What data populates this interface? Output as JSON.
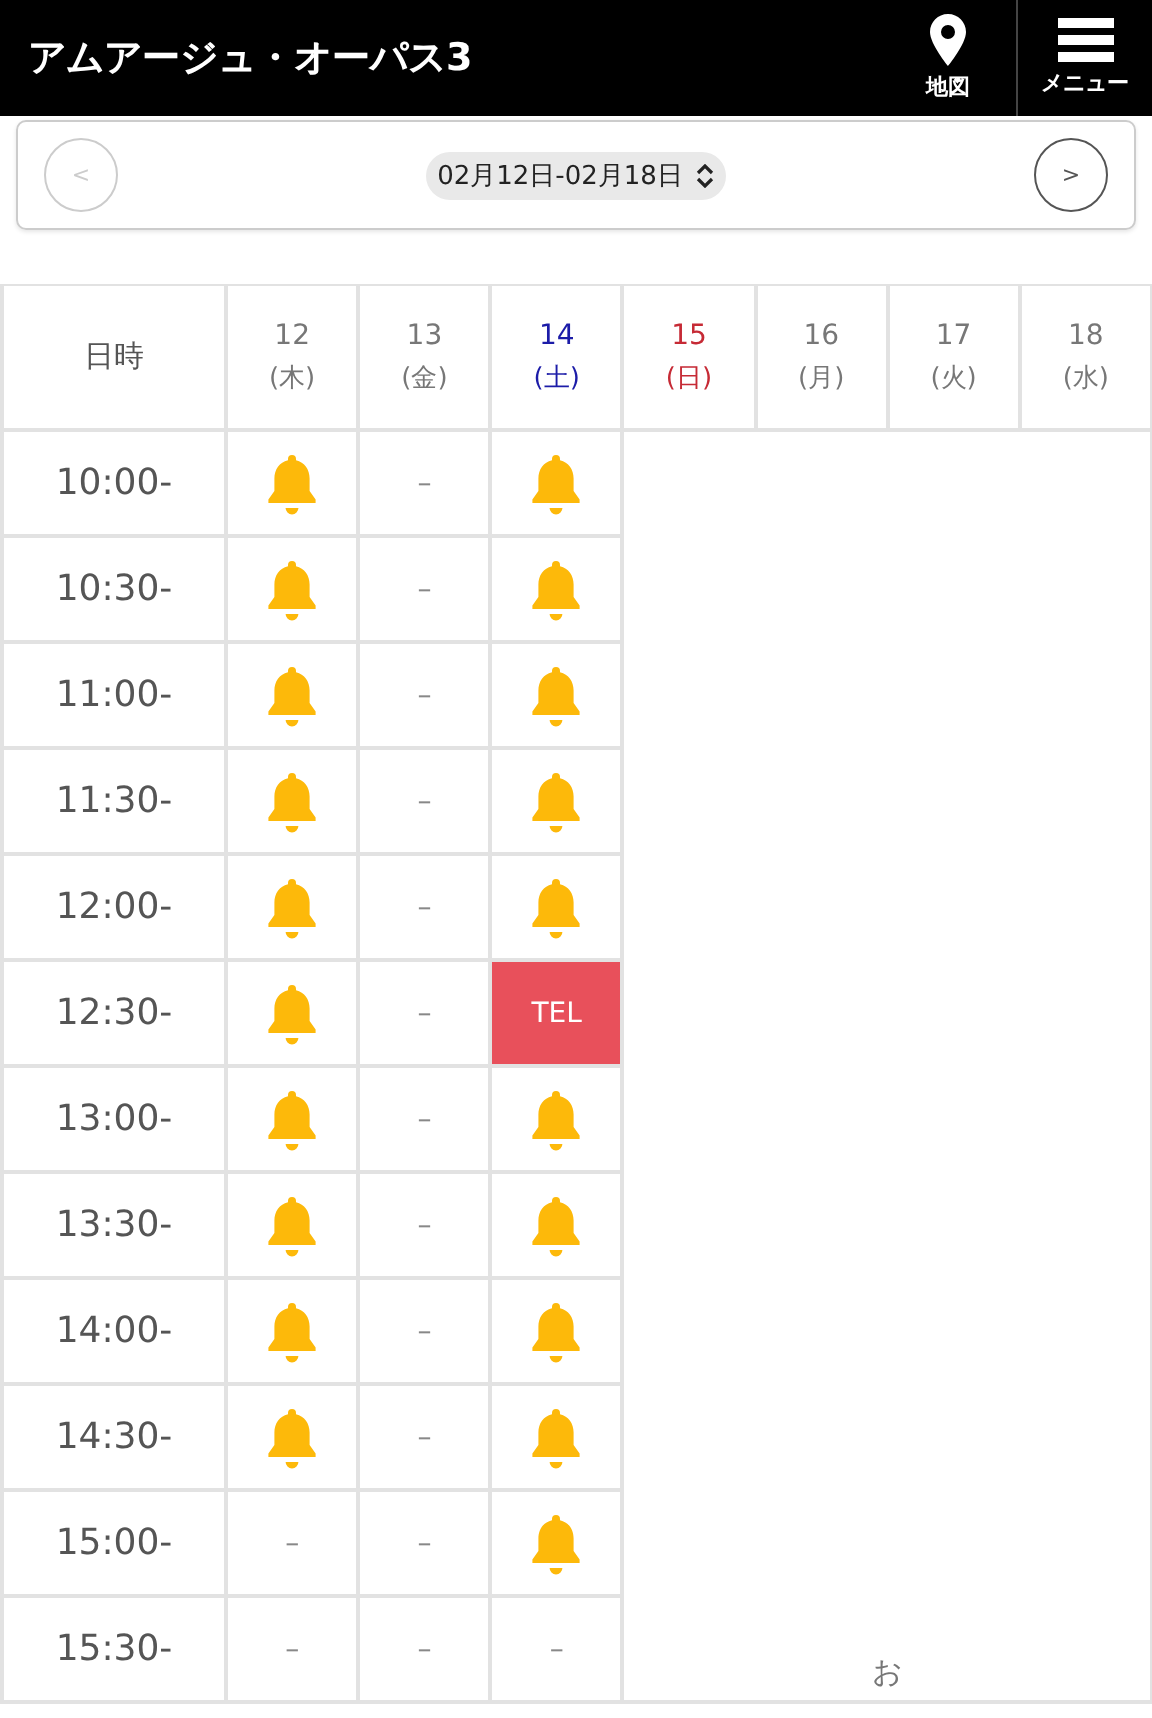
{
  "header": {
    "title": "アムアージュ・オーパス3",
    "actions": [
      {
        "kind": "map",
        "label": "地図"
      },
      {
        "kind": "menu",
        "label": "メニュー"
      }
    ]
  },
  "week_nav": {
    "prev": {
      "label": "<",
      "disabled": true
    },
    "range": "02月12日-02月18日",
    "next": {
      "label": ">",
      "disabled": false
    }
  },
  "table": {
    "corner": "日時",
    "columns": [
      {
        "day": "12",
        "weekday": "(木)",
        "kind": "weekday"
      },
      {
        "day": "13",
        "weekday": "(金)",
        "kind": "weekday"
      },
      {
        "day": "14",
        "weekday": "(土)",
        "kind": "saturday"
      },
      {
        "day": "15",
        "weekday": "(日)",
        "kind": "sunday"
      },
      {
        "day": "16",
        "weekday": "(月)",
        "kind": "weekday"
      },
      {
        "day": "17",
        "weekday": "(火)",
        "kind": "weekday"
      },
      {
        "day": "18",
        "weekday": "(水)",
        "kind": "weekday"
      }
    ],
    "rows": [
      {
        "time": "10:00-",
        "cells": [
          {
            "kind": "bell"
          },
          {
            "kind": "dash",
            "text": "–"
          },
          {
            "kind": "bell"
          }
        ]
      },
      {
        "time": "10:30-",
        "cells": [
          {
            "kind": "bell"
          },
          {
            "kind": "dash",
            "text": "–"
          },
          {
            "kind": "bell"
          }
        ]
      },
      {
        "time": "11:00-",
        "cells": [
          {
            "kind": "bell"
          },
          {
            "kind": "dash",
            "text": "–"
          },
          {
            "kind": "bell"
          }
        ]
      },
      {
        "time": "11:30-",
        "cells": [
          {
            "kind": "bell"
          },
          {
            "kind": "dash",
            "text": "–"
          },
          {
            "kind": "bell"
          }
        ]
      },
      {
        "time": "12:00-",
        "cells": [
          {
            "kind": "bell"
          },
          {
            "kind": "dash",
            "text": "–"
          },
          {
            "kind": "bell"
          }
        ]
      },
      {
        "time": "12:30-",
        "cells": [
          {
            "kind": "bell"
          },
          {
            "kind": "dash",
            "text": "–"
          },
          {
            "kind": "tel",
            "text": "TEL"
          }
        ]
      },
      {
        "time": "13:00-",
        "cells": [
          {
            "kind": "bell"
          },
          {
            "kind": "dash",
            "text": "–"
          },
          {
            "kind": "bell"
          }
        ]
      },
      {
        "time": "13:30-",
        "cells": [
          {
            "kind": "bell"
          },
          {
            "kind": "dash",
            "text": "–"
          },
          {
            "kind": "bell"
          }
        ]
      },
      {
        "time": "14:00-",
        "cells": [
          {
            "kind": "bell"
          },
          {
            "kind": "dash",
            "text": "–"
          },
          {
            "kind": "bell"
          }
        ]
      },
      {
        "time": "14:30-",
        "cells": [
          {
            "kind": "bell"
          },
          {
            "kind": "dash",
            "text": "–"
          },
          {
            "kind": "bell"
          }
        ]
      },
      {
        "time": "15:00-",
        "cells": [
          {
            "kind": "dash",
            "text": "–"
          },
          {
            "kind": "dash",
            "text": "–"
          },
          {
            "kind": "bell"
          }
        ]
      },
      {
        "time": "15:30-",
        "cells": [
          {
            "kind": "dash",
            "text": "–"
          },
          {
            "kind": "dash",
            "text": "–"
          },
          {
            "kind": "dash",
            "text": "–"
          }
        ]
      }
    ],
    "merged_note": "お"
  }
}
